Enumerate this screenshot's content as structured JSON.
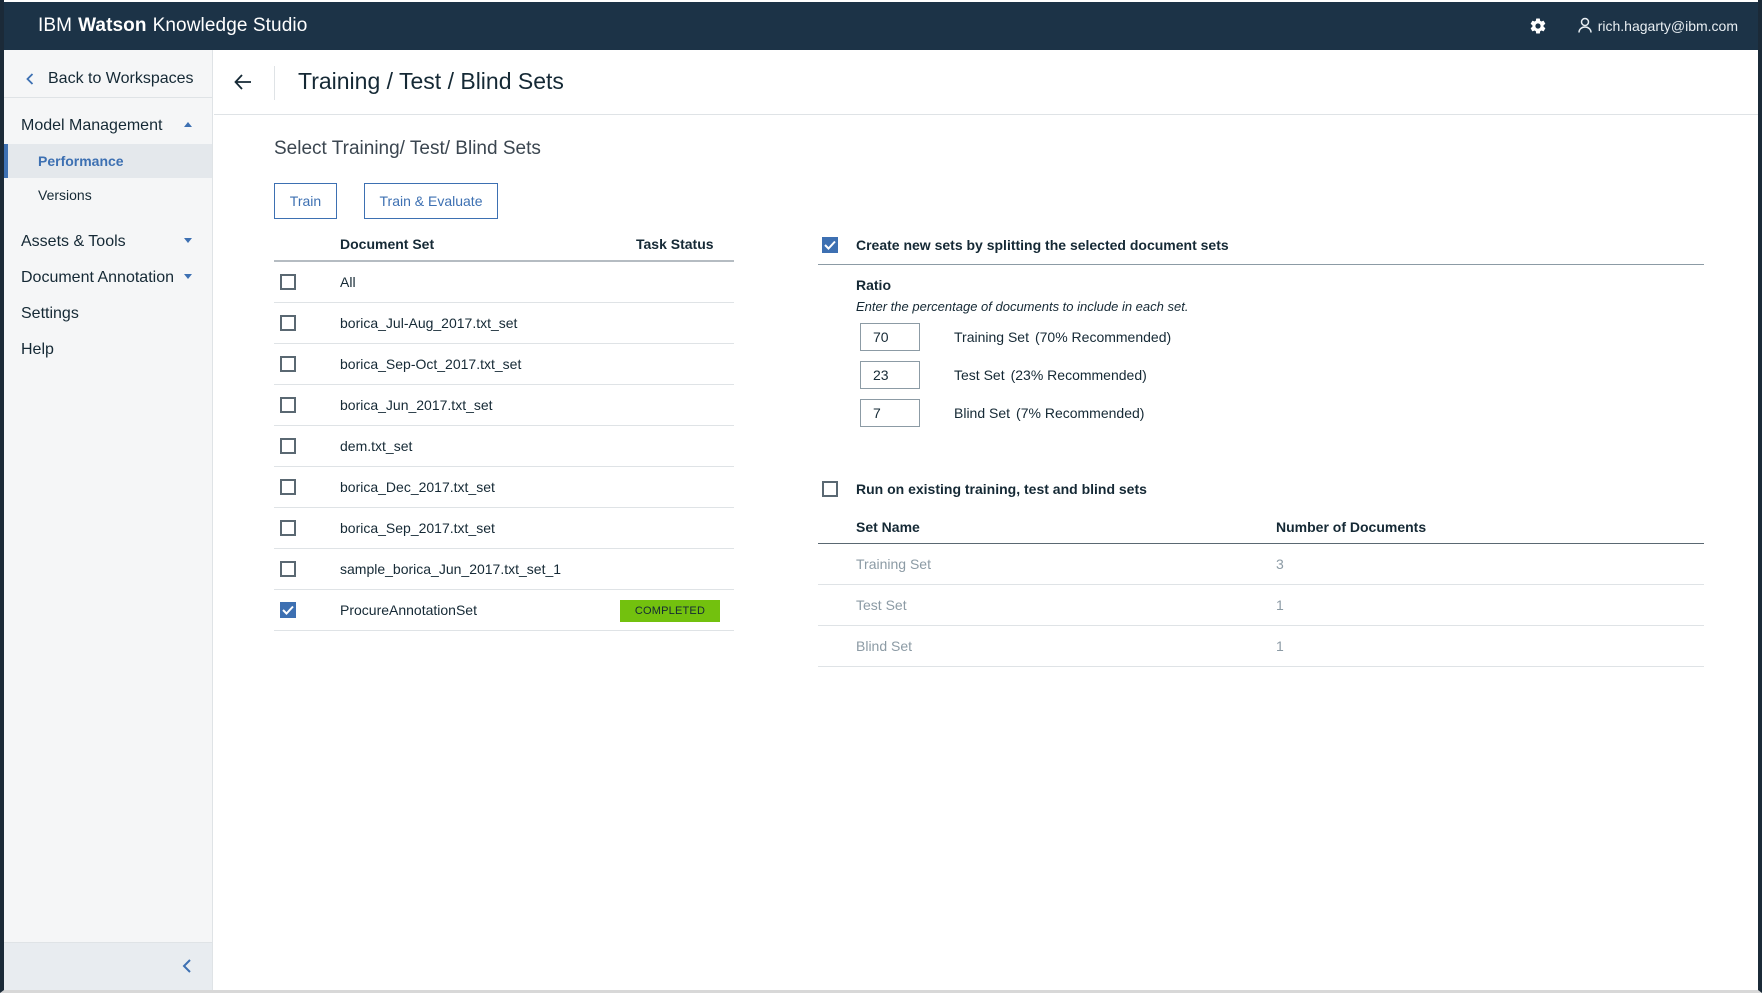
{
  "app": {
    "brand_prefix": "IBM",
    "brand_bold": "Watson",
    "brand_suffix": "Knowledge Studio",
    "user_email": "rich.hagarty@ibm.com"
  },
  "sidebar": {
    "back_label": "Back to Workspaces",
    "items": [
      {
        "label": "Model Management",
        "expanded": true
      },
      {
        "label": "Performance",
        "active": true
      },
      {
        "label": "Versions"
      },
      {
        "label": "Assets & Tools"
      },
      {
        "label": "Document Annotation"
      },
      {
        "label": "Settings"
      },
      {
        "label": "Help"
      }
    ]
  },
  "page": {
    "title": "Training / Test / Blind Sets",
    "section_title": "Select Training/ Test/ Blind Sets",
    "train_button": "Train",
    "train_evaluate_button": "Train & Evaluate"
  },
  "doc_table": {
    "col_document_set": "Document Set",
    "col_task_status": "Task Status",
    "rows": [
      {
        "name": "All",
        "checked": false,
        "status": ""
      },
      {
        "name": "borica_Jul-Aug_2017.txt_set",
        "checked": false,
        "status": ""
      },
      {
        "name": "borica_Sep-Oct_2017.txt_set",
        "checked": false,
        "status": ""
      },
      {
        "name": "borica_Jun_2017.txt_set",
        "checked": false,
        "status": ""
      },
      {
        "name": "dem.txt_set",
        "checked": false,
        "status": ""
      },
      {
        "name": "borica_Dec_2017.txt_set",
        "checked": false,
        "status": ""
      },
      {
        "name": "borica_Sep_2017.txt_set",
        "checked": false,
        "status": ""
      },
      {
        "name": "sample_borica_Jun_2017.txt_set_1",
        "checked": false,
        "status": ""
      },
      {
        "name": "ProcureAnnotationSet",
        "checked": true,
        "status": "COMPLETED"
      }
    ]
  },
  "split": {
    "label": "Create new sets by splitting the selected document sets",
    "checked": true,
    "ratio_title": "Ratio",
    "ratio_help": "Enter the percentage of documents to include in each set.",
    "rows": [
      {
        "value": "70",
        "label": "Training Set",
        "recommend": "(70% Recommended)"
      },
      {
        "value": "23",
        "label": "Test Set",
        "recommend": "(23% Recommended)"
      },
      {
        "value": "7",
        "label": "Blind Set",
        "recommend": "(7% Recommended)"
      }
    ]
  },
  "existing": {
    "label": "Run on existing training, test and blind sets",
    "checked": false,
    "col_set_name": "Set Name",
    "col_num_docs": "Number of Documents",
    "rows": [
      {
        "name": "Training Set",
        "count": "3"
      },
      {
        "name": "Test Set",
        "count": "1"
      },
      {
        "name": "Blind Set",
        "count": "1"
      }
    ]
  },
  "colors": {
    "header_bg": "#1c3347",
    "accent": "#3d70b2",
    "completed": "#73c10e"
  }
}
